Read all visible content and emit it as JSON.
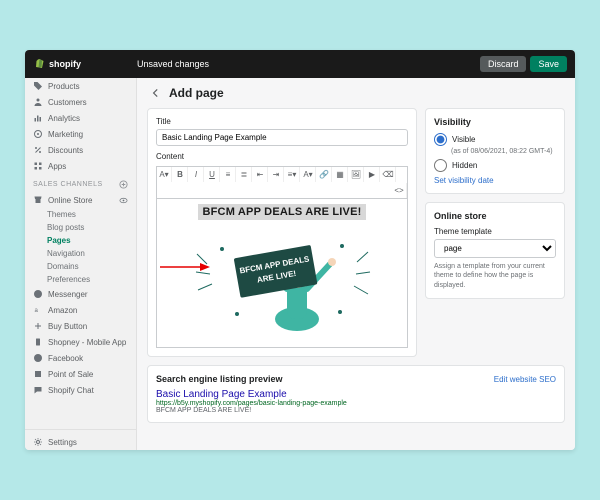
{
  "brand": "shopify",
  "topbar": {
    "unsaved": "Unsaved changes",
    "discard": "Discard",
    "save": "Save"
  },
  "sidebar": {
    "items": [
      {
        "label": "Products"
      },
      {
        "label": "Customers"
      },
      {
        "label": "Analytics"
      },
      {
        "label": "Marketing"
      },
      {
        "label": "Discounts"
      },
      {
        "label": "Apps"
      }
    ],
    "section_header": "SALES CHANNELS",
    "online_store": {
      "label": "Online Store",
      "subs": [
        "Themes",
        "Blog posts",
        "Pages",
        "Navigation",
        "Domains",
        "Preferences"
      ]
    },
    "channels": [
      {
        "label": "Messenger"
      },
      {
        "label": "Amazon"
      },
      {
        "label": "Buy Button"
      },
      {
        "label": "Shopney - Mobile App"
      },
      {
        "label": "Facebook"
      },
      {
        "label": "Point of Sale"
      },
      {
        "label": "Shopify Chat"
      }
    ],
    "settings": "Settings"
  },
  "page": {
    "title": "Add page",
    "title_label": "Title",
    "title_value": "Basic Landing Page Example",
    "content_label": "Content",
    "headline": "BFCM APP DEALS ARE LIVE!",
    "sign_line1": "BFCM APP DEALS",
    "sign_line2": "ARE LIVE!"
  },
  "visibility": {
    "card_title": "Visibility",
    "visible_label": "Visible",
    "visible_note": "(as of 08/06/2021, 08:22 GMT-4)",
    "hidden_label": "Hidden",
    "set_date": "Set visibility date"
  },
  "onlinestore": {
    "card_title": "Online store",
    "theme_label": "Theme template",
    "theme_value": "page",
    "help": "Assign a template from your current theme to define how the page is displayed."
  },
  "seo": {
    "heading": "Search engine listing preview",
    "edit": "Edit website SEO",
    "preview_title": "Basic Landing Page Example",
    "preview_url": "https://b5y.myshopify.com/pages/basic-landing-page-example",
    "preview_desc": "BFCM APP DEALS ARE LIVE!"
  }
}
